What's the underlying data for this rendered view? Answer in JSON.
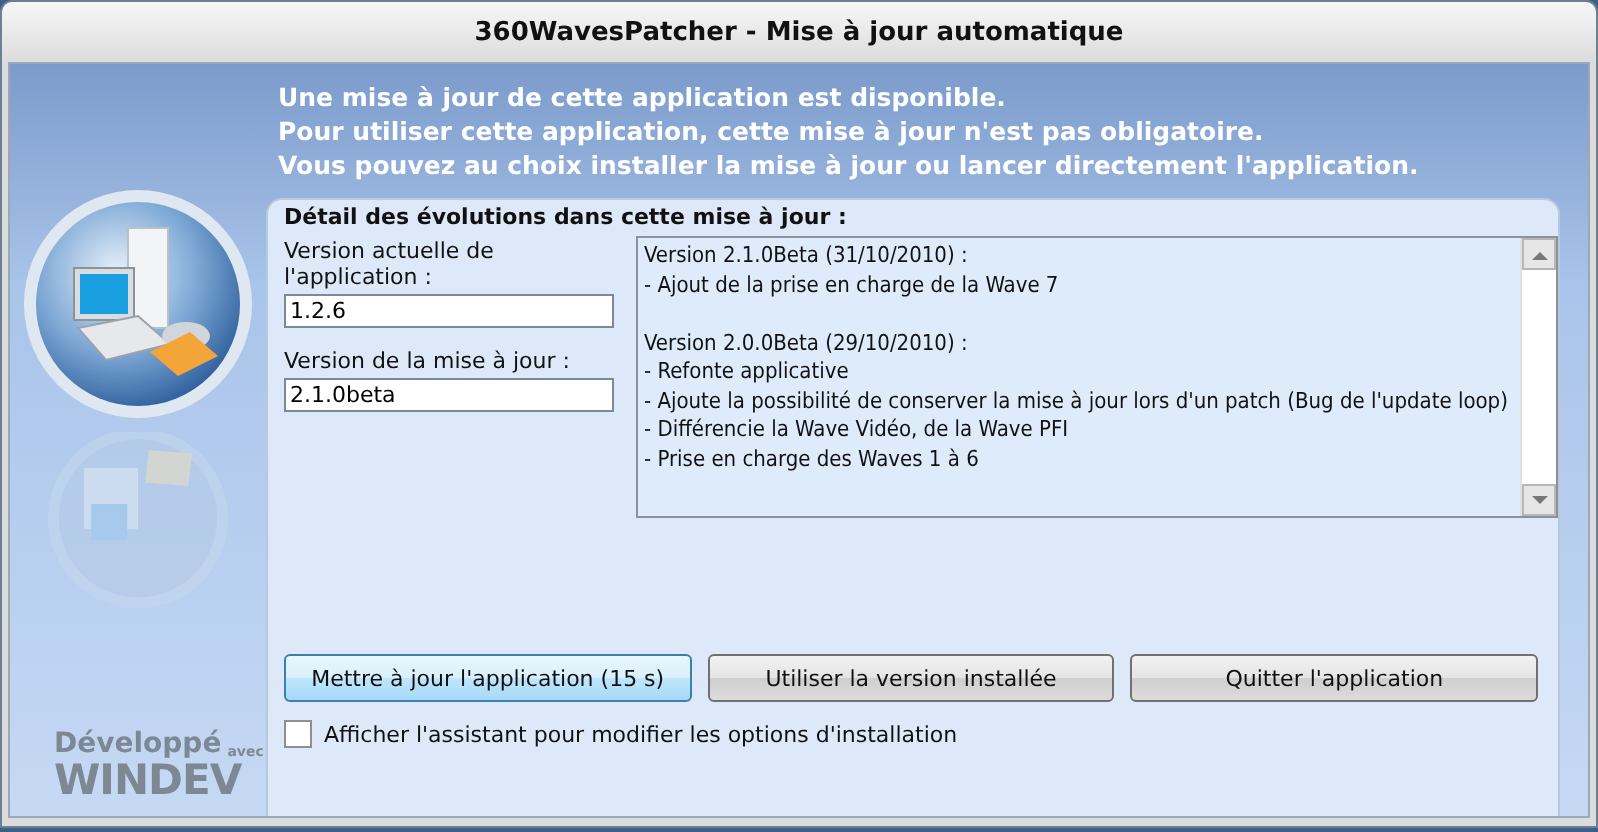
{
  "window": {
    "title": "360WavesPatcher - Mise à jour automatique"
  },
  "message": [
    "Une mise à jour de cette application est disponible.",
    "Pour utiliser cette application, cette mise à jour n'est pas obligatoire.",
    "Vous pouvez au choix installer la mise à jour ou lancer directement l'application."
  ],
  "details": {
    "title": "Détail des évolutions dans cette mise à jour :",
    "fields": [
      {
        "label": "Version actuelle de l'application :",
        "value": "1.2.6"
      },
      {
        "label": "Version de la mise à jour :",
        "value": "2.1.0beta"
      }
    ],
    "changelog": [
      {
        "header": "Version 2.1.0Beta (31/10/2010) :",
        "lines": [
          "- Ajout de la prise en charge de la Wave 7"
        ]
      },
      {
        "header": "Version 2.0.0Beta (29/10/2010) :",
        "lines": [
          "- Refonte applicative",
          "- Ajoute la possibilité de conserver la mise à jour lors d'un patch (Bug de l'update loop)",
          "- Différencie la Wave Vidéo, de la Wave PFI",
          "- Prise en charge des Waves 1 à 6"
        ]
      }
    ]
  },
  "buttons": [
    {
      "label": "Mettre à jour l'application (15 s)",
      "selected": true
    },
    {
      "label": "Utiliser la version installée",
      "selected": false
    },
    {
      "label": "Quitter l'application",
      "selected": false
    }
  ],
  "option": {
    "label": "Afficher l'assistant pour modifier les options d'installation",
    "checked": false
  },
  "branding": {
    "line1": "Développé",
    "small": "avec",
    "line2": "WINDEV"
  }
}
